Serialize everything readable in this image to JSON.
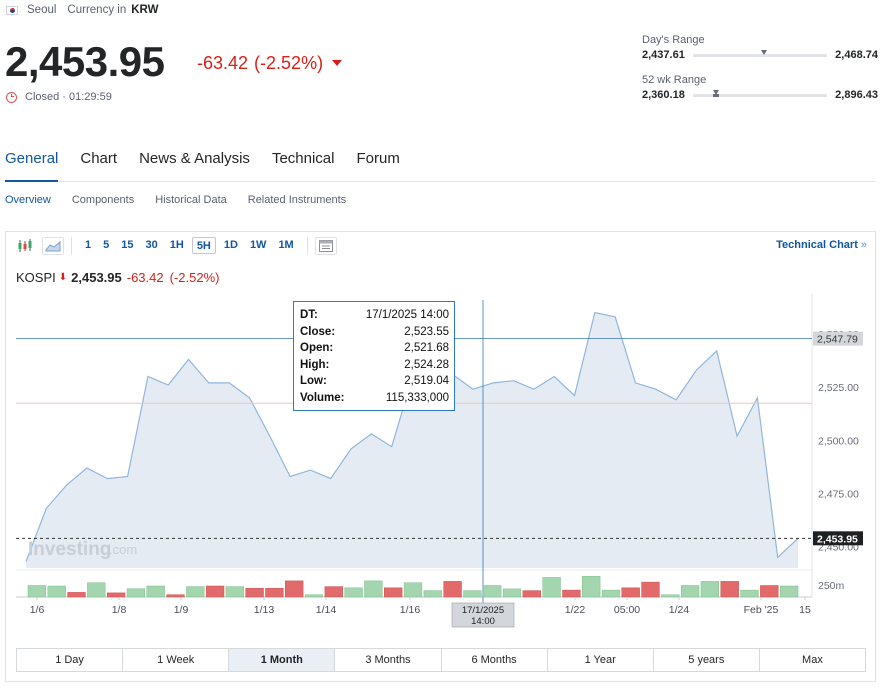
{
  "header": {
    "market": "Seoul",
    "currency_label": "Currency in",
    "currency": "KRW",
    "price": "2,453.95",
    "change": "-63.42",
    "change_pct": "(-2.52%)",
    "status": "Closed · 01:29:59",
    "days_range": {
      "label": "Day's Range",
      "low": "2,437.61",
      "high": "2,468.74",
      "current_pos": 0.53
    },
    "wk52_range": {
      "label": "52 wk Range",
      "low": "2,360.18",
      "high": "2,896.43",
      "current_pos": 0.175
    }
  },
  "tabs": [
    "General",
    "Chart",
    "News & Analysis",
    "Technical",
    "Forum"
  ],
  "active_tab": "General",
  "subtabs": [
    "Overview",
    "Components",
    "Historical Data",
    "Related Instruments"
  ],
  "active_subtab": "Overview",
  "toolbar": {
    "intervals": [
      "1",
      "5",
      "15",
      "30",
      "1H",
      "5H",
      "1D",
      "1W",
      "1M"
    ],
    "active_interval": "5H",
    "technical_link": "Technical Chart",
    "technical_chevron": "»"
  },
  "legend": {
    "symbol": "KOSPI",
    "arrow": "⬇",
    "last": "2,453.95",
    "change": "-63.42",
    "change_pct": "(-2.52%)"
  },
  "tooltip": {
    "rows": [
      {
        "k": "DT:",
        "v": "17/1/2025 14:00"
      },
      {
        "k": "Close:",
        "v": "2,523.55"
      },
      {
        "k": "Open:",
        "v": "2,521.68"
      },
      {
        "k": "High:",
        "v": "2,524.28"
      },
      {
        "k": "Low:",
        "v": "2,519.04"
      },
      {
        "k": "Volume:",
        "v": "115,333,000"
      }
    ]
  },
  "chart_data": {
    "type": "area",
    "series": [
      {
        "values": [
          2443,
          2468,
          2479,
          2487,
          2482,
          2483,
          2530,
          2526,
          2538,
          2527,
          2527,
          2520,
          2502,
          2483,
          2486,
          2482,
          2496,
          2503,
          2497,
          2529,
          2526,
          2531,
          2524,
          2527,
          2528,
          2524,
          2530,
          2521,
          2560,
          2558,
          2527,
          2524,
          2519,
          2533,
          2542,
          2502,
          2520,
          2445,
          2453.95
        ]
      }
    ],
    "x_tick_labels": [
      "1/6",
      "1/8",
      "1/9",
      "1/13",
      "1/14",
      "1/16",
      "1/22",
      "05:00",
      "1/24",
      "Feb '25",
      "15"
    ],
    "crosshair_x_label": "17/1/2025\n14:00",
    "y_tick_labels": [
      "2,550.00",
      "2,525.00",
      "2,500.00",
      "2,475.00",
      "2,450.00"
    ],
    "y_min": 2440,
    "y_max": 2565,
    "price_labels": {
      "crosshair": "2,547.79",
      "last": "2,453.95"
    },
    "volume_label": "250m",
    "volume": [
      {
        "v": 0.5,
        "up": true
      },
      {
        "v": 0.48,
        "up": true
      },
      {
        "v": 0.2,
        "up": false
      },
      {
        "v": 0.62,
        "up": true
      },
      {
        "v": 0.18,
        "up": false
      },
      {
        "v": 0.36,
        "up": true
      },
      {
        "v": 0.48,
        "up": true
      },
      {
        "v": 0.1,
        "up": false
      },
      {
        "v": 0.45,
        "up": true
      },
      {
        "v": 0.48,
        "up": false
      },
      {
        "v": 0.45,
        "up": true
      },
      {
        "v": 0.38,
        "up": false
      },
      {
        "v": 0.38,
        "up": false
      },
      {
        "v": 0.7,
        "up": false
      },
      {
        "v": 0.1,
        "up": true
      },
      {
        "v": 0.45,
        "up": false
      },
      {
        "v": 0.4,
        "up": true
      },
      {
        "v": 0.7,
        "up": true
      },
      {
        "v": 0.4,
        "up": false
      },
      {
        "v": 0.62,
        "up": true
      },
      {
        "v": 0.28,
        "up": true
      },
      {
        "v": 0.68,
        "up": false
      },
      {
        "v": 0.28,
        "up": true
      },
      {
        "v": 0.5,
        "up": true
      },
      {
        "v": 0.35,
        "up": true
      },
      {
        "v": 0.28,
        "up": false
      },
      {
        "v": 0.85,
        "up": true
      },
      {
        "v": 0.3,
        "up": false
      },
      {
        "v": 0.9,
        "up": true
      },
      {
        "v": 0.3,
        "up": true
      },
      {
        "v": 0.4,
        "up": false
      },
      {
        "v": 0.65,
        "up": false
      },
      {
        "v": 0.1,
        "up": true
      },
      {
        "v": 0.5,
        "up": true
      },
      {
        "v": 0.68,
        "up": true
      },
      {
        "v": 0.68,
        "up": false
      },
      {
        "v": 0.3,
        "up": true
      },
      {
        "v": 0.5,
        "up": false
      },
      {
        "v": 0.48,
        "up": true
      }
    ],
    "watermark": "Investing",
    "watermark_suffix": ".com"
  },
  "periods": [
    "1 Day",
    "1 Week",
    "1 Month",
    "3 Months",
    "6 Months",
    "1 Year",
    "5 years",
    "Max"
  ],
  "active_period": "1 Month",
  "colors": {
    "accent": "#1256a0",
    "down": "#d91e18",
    "vol_up": "#a3d6ae",
    "vol_down": "#e36a6a",
    "area_fill": "#e4ebf3",
    "area_line": "#8fb7dd"
  }
}
